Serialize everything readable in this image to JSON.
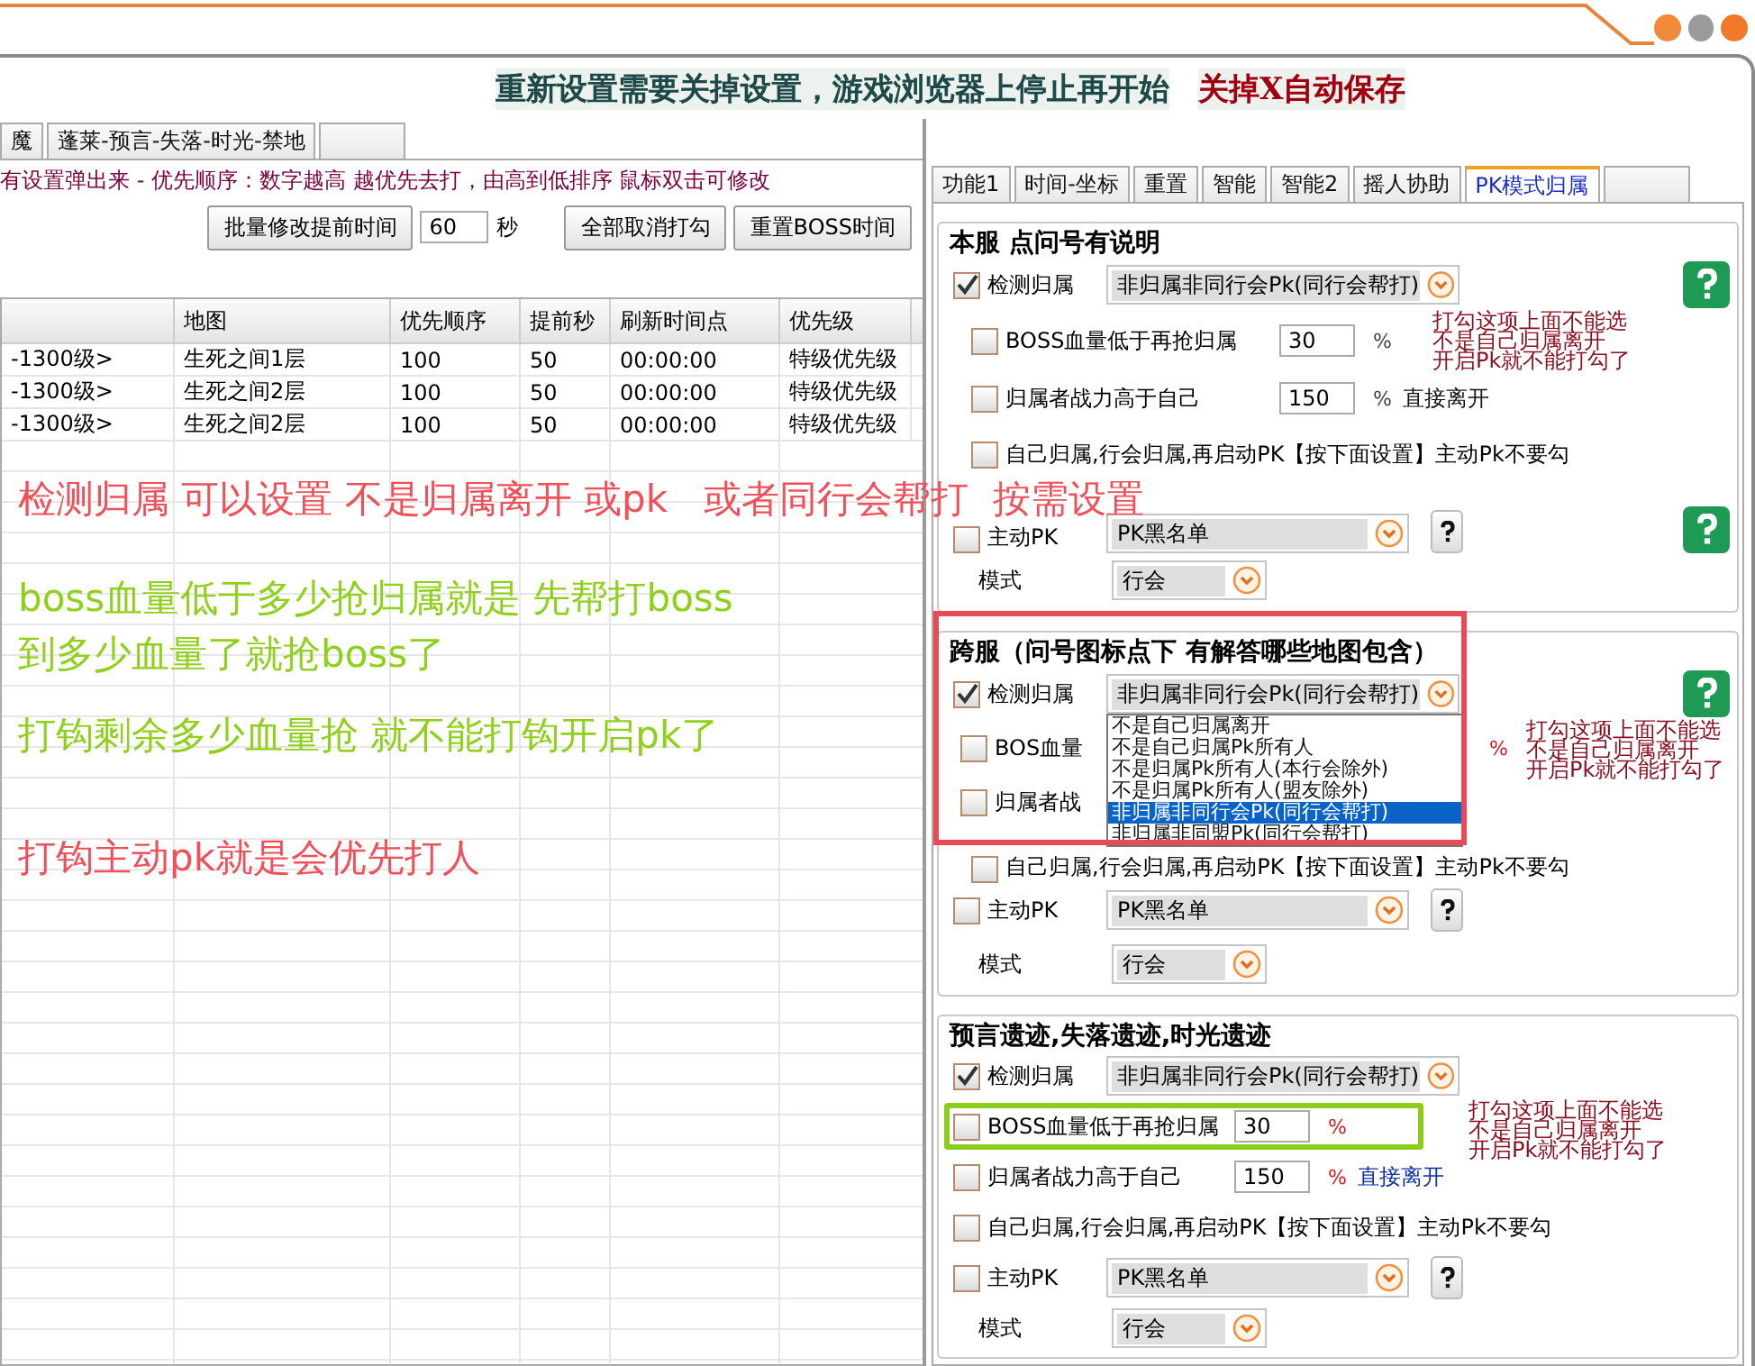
{
  "banner": {
    "text": "重新设置需要关掉设置，游戏浏览器上停止再开始",
    "warning": "关掉X自动保存"
  },
  "left_tabs": [
    {
      "label": "魔"
    },
    {
      "label": "蓬莱-预言-失落-时光-禁地"
    }
  ],
  "hint": "有设置弹出来  - 优先顺序：数字越高 越优先去打，由高到低排序 鼠标双击可修改",
  "toolbar": {
    "batch_button": "批量修改提前时间",
    "seconds_value": "60",
    "seconds_unit": "秒",
    "clear_button": "全部取消打勾",
    "reset_button": "重置BOSS时间"
  },
  "table": {
    "columns": [
      "地图",
      "优先顺序",
      "提前秒",
      "刷新时间点",
      "优先级"
    ],
    "rows": [
      {
        "column_1": "-1300级>",
        "cells": [
          "生死之间1层",
          "100",
          "50",
          "00:00:00",
          "特级优先级"
        ]
      },
      {
        "column_1": "-1300级>",
        "cells": [
          "生死之间2层",
          "100",
          "50",
          "00:00:00",
          "特级优先级"
        ]
      },
      {
        "column_1": "-1300级>",
        "cells": [
          "生死之间2层",
          "100",
          "50",
          "00:00:00",
          "特级优先级"
        ]
      }
    ]
  },
  "right_tabs": [
    {
      "label": "功能1",
      "selected": false
    },
    {
      "label": "时间-坐标",
      "selected": false
    },
    {
      "label": "重置",
      "selected": false
    },
    {
      "label": "智能",
      "selected": false
    },
    {
      "label": "智能2",
      "selected": false
    },
    {
      "label": "摇人协助",
      "selected": false
    },
    {
      "label": "PK模式归属",
      "selected": true
    }
  ],
  "groups": [
    {
      "title": "本服  点问号有说明",
      "highlighted": false,
      "note": [
        "打勾这项上面不能选",
        "不是自己归属离开",
        "开启Pk就不能打勾了"
      ],
      "rows": [
        {
          "kind": "detect",
          "label": "检测归属",
          "checked": true,
          "value": "非归属非同行会Pk(同行会帮打)",
          "help": true
        },
        {
          "kind": "threshold",
          "label": "BOSS血量低于再抢归属",
          "checked": false,
          "value": "30",
          "unit": "%",
          "highlighted": false
        },
        {
          "kind": "threshold",
          "label": "归属者战力高于自己",
          "checked": false,
          "value": "150",
          "unit": "%",
          "suffix": "直接离开",
          "highlighted": false
        },
        {
          "kind": "option",
          "label": "自己归属,行会归属,再启动PK【按下面设置】主动Pk不要勾",
          "checked": false
        },
        {
          "kind": "pk",
          "label": "主动PK",
          "checked": false,
          "value": "PK黑名单",
          "help": true
        },
        {
          "kind": "mode",
          "label": "模式",
          "value": "行会"
        }
      ]
    },
    {
      "title": "跨服（问号图标点下 有解答哪些地图包含）",
      "highlighted": true,
      "note": [
        "打勾这项上面不能选",
        "不是自己归属离开",
        "开启Pk就不能打勾了"
      ],
      "rows": [
        {
          "kind": "detect",
          "label": "检测归属",
          "checked": true,
          "value": "非归属非同行会Pk(同行会帮打)",
          "help": true,
          "options": [
            {
              "label": "不是自己归属离开",
              "selected": false
            },
            {
              "label": "不是自己归属Pk所有人",
              "selected": false
            },
            {
              "label": "不是归属Pk所有人(本行会除外)",
              "selected": false
            },
            {
              "label": "不是归属Pk所有人(盟友除外)",
              "selected": false
            },
            {
              "label": "非归属非同行会Pk(同行会帮打)",
              "selected": true
            },
            {
              "label": "非归属非同盟Pk(同行会帮打)",
              "selected": false
            }
          ]
        },
        {
          "kind": "threshold",
          "label": "BOS血量",
          "checked": false,
          "unit": "%",
          "highlighted": false
        },
        {
          "kind": "threshold",
          "label": "归属者战",
          "checked": false,
          "highlighted": false
        },
        {
          "kind": "option",
          "label": "自己归属,行会归属,再启动PK【按下面设置】主动Pk不要勾",
          "checked": false
        },
        {
          "kind": "pk",
          "label": "主动PK",
          "checked": false,
          "value": "PK黑名单",
          "help": false
        },
        {
          "kind": "mode",
          "label": "模式",
          "value": "行会"
        }
      ]
    },
    {
      "title": "预言遗迹,失落遗迹,时光遗迹",
      "highlighted": false,
      "note": [
        "打勾这项上面不能选",
        "不是自己归属离开",
        "开启Pk就不能打勾了"
      ],
      "rows": [
        {
          "kind": "detect",
          "label": "检测归属",
          "checked": true,
          "value": "非归属非同行会Pk(同行会帮打)",
          "help": false
        },
        {
          "kind": "threshold",
          "label": "BOSS血量低于再抢归属",
          "checked": false,
          "value": "30",
          "unit": "%",
          "highlighted": true
        },
        {
          "kind": "threshold",
          "label": "归属者战力高于自己",
          "checked": false,
          "value": "150",
          "unit": "%",
          "suffix": "直接离开",
          "highlighted": false
        },
        {
          "kind": "option",
          "label": "自己归属,行会归属,再启动PK【按下面设置】主动Pk不要勾",
          "checked": false
        },
        {
          "kind": "pk",
          "label": "主动PK",
          "checked": false,
          "value": "PK黑名单",
          "help": false
        },
        {
          "kind": "mode",
          "label": "模式",
          "value": "行会"
        }
      ]
    }
  ],
  "annotations": [
    {
      "text": "检测归属 可以设置 不是归属离开 或pk   或者同行会帮打  按需设置",
      "color": "#f0505a"
    },
    {
      "text": "boss血量低于多少抢归属就是 先帮打boss",
      "color": "#8fd11a"
    },
    {
      "text": "到多少血量了就抢boss了",
      "color": "#8fd11a"
    },
    {
      "text": "打钩剩余多少血量抢 就不能打钩开启pk了",
      "color": "#8fd11a"
    },
    {
      "text": "打钩主动pk就是会优先打人",
      "color": "#f0505a"
    }
  ]
}
